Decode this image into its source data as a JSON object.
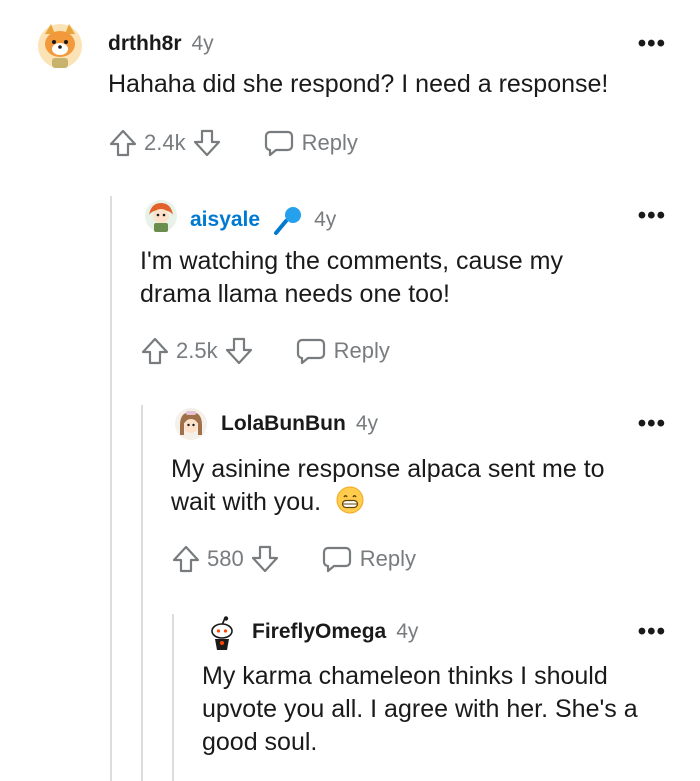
{
  "comments": [
    {
      "username": "drthh8r",
      "age": "4y",
      "text_lines": [
        "Hahaha did she respond? I need a response!"
      ],
      "score": "2.4k",
      "reply_label": "Reply",
      "more_label": "•••"
    },
    {
      "username": "aisyale",
      "age": "4y",
      "text_lines": [
        "I'm watching the comments, cause my",
        "drama llama needs one too!"
      ],
      "score": "2.5k",
      "reply_label": "Reply",
      "more_label": "•••"
    },
    {
      "username": "LolaBunBun",
      "age": "4y",
      "text_lines": [
        "My asinine response alpaca sent me to",
        "wait with you."
      ],
      "score": "580",
      "reply_label": "Reply",
      "more_label": "•••"
    },
    {
      "username": "FireflyOmega",
      "age": "4y",
      "text_lines": [
        "My karma chameleon thinks I should",
        "upvote you all. I agree with her. She's a",
        "good soul."
      ],
      "more_label": "•••"
    }
  ],
  "colors": {
    "op_username": "#0079d3",
    "meta_gray": "#787c7e",
    "thread_line": "#dadcde"
  },
  "icons": [
    "upvote-icon",
    "downvote-icon",
    "reply-bubble-icon",
    "microphone-icon",
    "grinning-emoji-icon"
  ]
}
